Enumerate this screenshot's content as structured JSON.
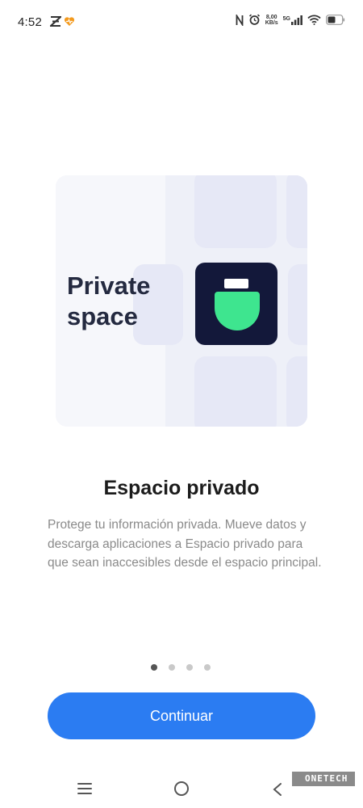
{
  "status_bar": {
    "time": "4:52",
    "speed_value": "8,00",
    "speed_unit": "KB/s",
    "network": "5G",
    "icons": [
      "notification-app-icon",
      "heart-app-icon",
      "nfc-icon",
      "alarm-icon",
      "signal-icon",
      "wifi-icon",
      "battery-icon"
    ]
  },
  "hero": {
    "title_line1": "Private",
    "title_line2": "space",
    "app_icon": "private-space-icon"
  },
  "content": {
    "title": "Espacio privado",
    "description": "Protege tu información privada. Mueve datos y descarga aplicaciones a Espacio privado para que sean inaccesibles desde el espacio principal."
  },
  "pagination": {
    "pages": 4,
    "active": 1
  },
  "actions": {
    "continue_label": "Continuar"
  },
  "colors": {
    "primary": "#2b7cf2",
    "icon_bg": "#13183a",
    "icon_green": "#3ee58f"
  },
  "nav": {
    "icons": [
      "menu-icon",
      "home-icon",
      "back-icon"
    ]
  },
  "watermark": {
    "text": "ONETECH"
  }
}
